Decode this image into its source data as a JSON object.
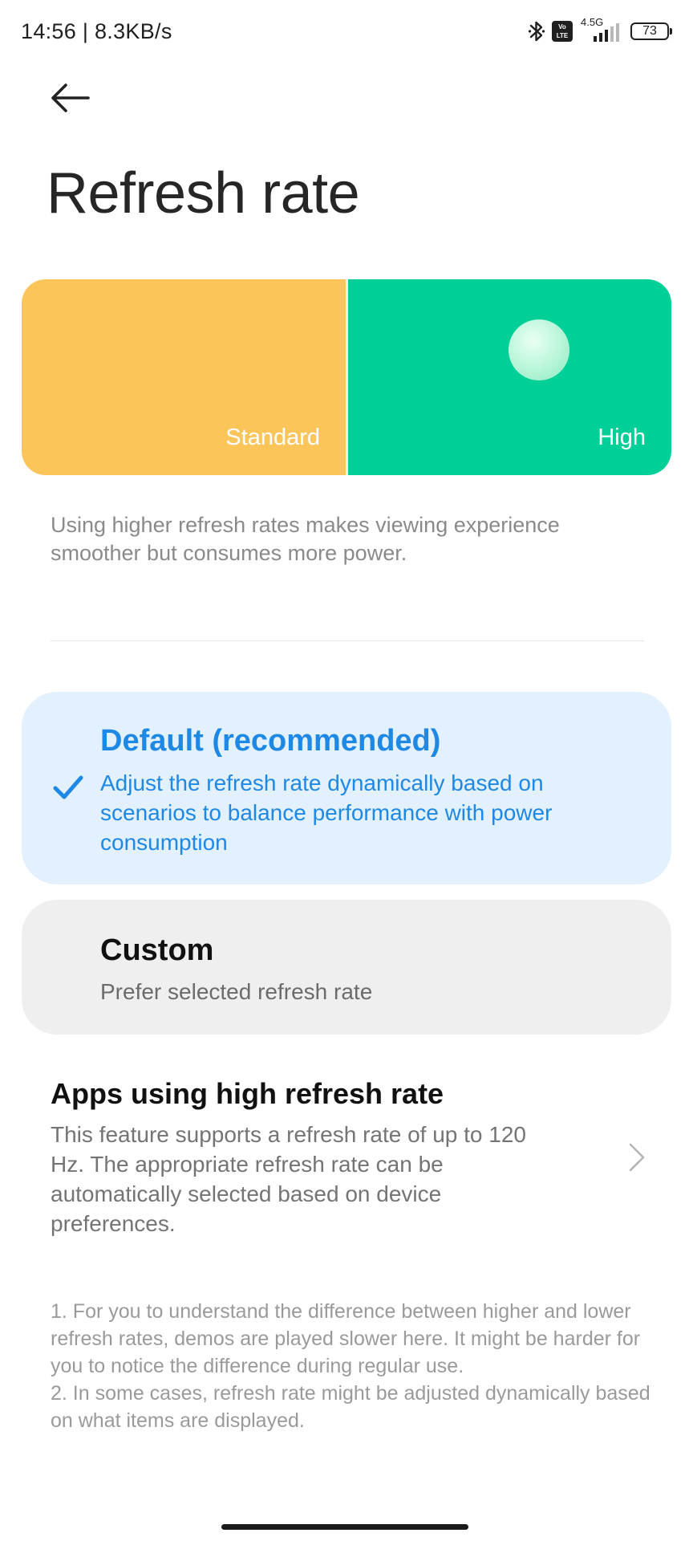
{
  "status_bar": {
    "time_speed": "14:56 | 8.3KB/s",
    "volte_line1": "Vo",
    "volte_line2": "LTE",
    "network": "4.5G",
    "battery": "73",
    "icons": [
      "bluetooth-icon",
      "volte-icon",
      "signal-icon",
      "battery-icon"
    ]
  },
  "header": {
    "back_icon": "arrow-left-icon",
    "title": "Refresh rate"
  },
  "preview": {
    "standard_label": "Standard",
    "high_label": "High",
    "colors": {
      "standard": "#fcc55a",
      "high": "#00cf98"
    }
  },
  "description": "Using higher refresh rates makes viewing experience smoother but consumes more power.",
  "options": [
    {
      "title": "Default (recommended)",
      "description": "Adjust the refresh rate dynamically based on scenarios to balance performance with power consumption",
      "selected": true,
      "icon": "checkmark-icon"
    },
    {
      "title": "Custom",
      "description": "Prefer selected refresh rate",
      "selected": false
    }
  ],
  "apps_row": {
    "title": "Apps using high refresh rate",
    "description": "This feature supports a refresh rate of up to 120 Hz. The appropriate refresh rate can be automatically selected based on device preferences.",
    "icon": "chevron-right-icon"
  },
  "footnote": {
    "line1": "1. For you to understand the difference between higher and lower refresh rates, demos are played slower here. It might be harder for you to notice the difference during regular use.",
    "line2": "2. In some cases, refresh rate might be adjusted dynamically based on what items are displayed."
  },
  "accent_color": "#1e88e5"
}
